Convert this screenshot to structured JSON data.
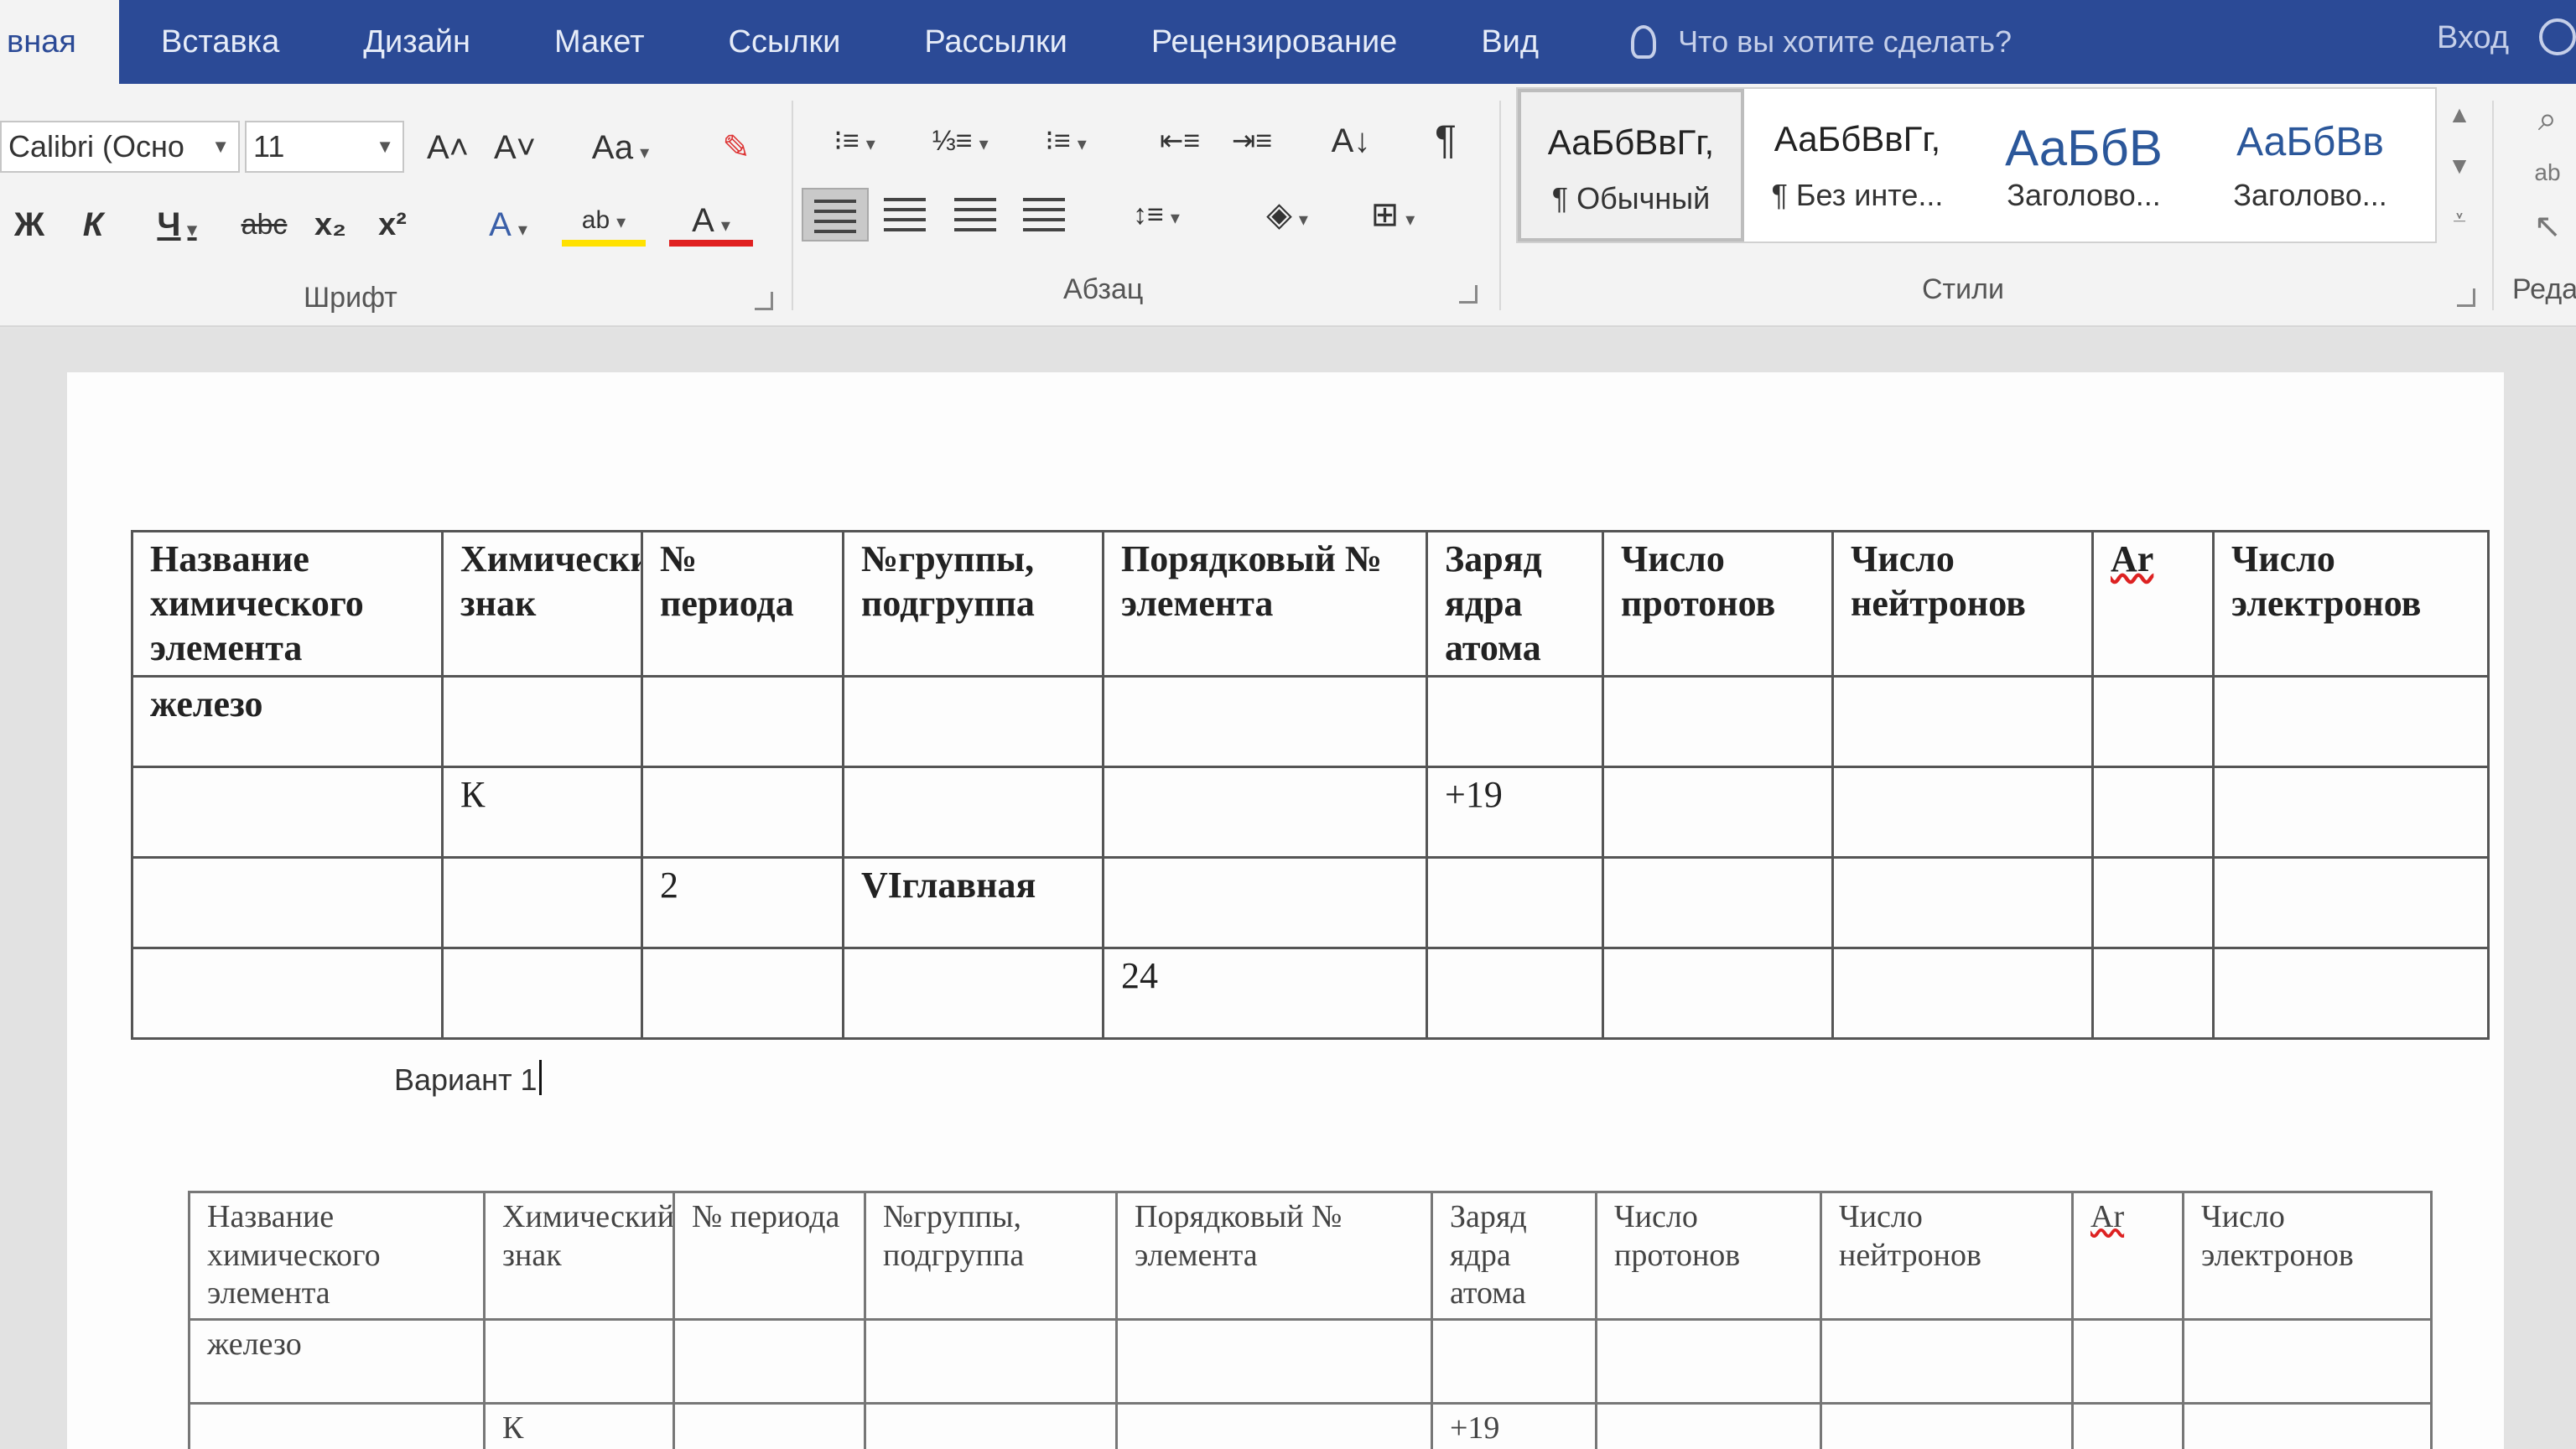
{
  "tabs": [
    "вная",
    "Вставка",
    "Дизайн",
    "Макет",
    "Ссылки",
    "Рассылки",
    "Рецензирование",
    "Вид"
  ],
  "tell_me": "Что вы хотите сделать?",
  "signin": "Вход",
  "font": {
    "name": "Calibri (Осно",
    "size": "11",
    "grow": "A˄",
    "shrink": "A˅",
    "case": "Аа",
    "bold": "Ж",
    "italic": "К",
    "underline": "Ч",
    "strike": "abc",
    "subscript": "x₂",
    "superscript": "x²",
    "group_label": "Шрифт"
  },
  "paragraph": {
    "group_label": "Абзац",
    "sort": "А↓",
    "pilcrow": "¶"
  },
  "styles": {
    "group_label": "Стили",
    "items": [
      {
        "preview": "АаБбВвГг,",
        "name": "¶ Обычный"
      },
      {
        "preview": "АаБбВвГг,",
        "name": "¶ Без инте..."
      },
      {
        "preview": "АаБбВ",
        "name": "Заголово..."
      },
      {
        "preview": "АаБбВв",
        "name": "Заголово..."
      }
    ]
  },
  "editing": {
    "group_label": "Реда"
  },
  "table_headers": [
    "Название химического элемента",
    "Химический знак",
    "№ периода",
    "№группы, подгруппа",
    "Порядковый № элемента",
    "Заряд ядра атома",
    "Число протонов",
    "Число нейтронов",
    "Ar",
    "Число электронов"
  ],
  "table1_rows": [
    [
      "железо",
      "",
      "",
      "",
      "",
      "",
      "",
      "",
      "",
      ""
    ],
    [
      "",
      "К",
      "",
      "",
      "",
      "+19",
      "",
      "",
      "",
      ""
    ],
    [
      "",
      "",
      "2",
      "VIглавная",
      "",
      "",
      "",
      "",
      "",
      ""
    ],
    [
      "",
      "",
      "",
      "",
      "24",
      "",
      "",
      "",
      "",
      ""
    ]
  ],
  "variant_label": "Вариант 1",
  "table2_rows": [
    [
      "железо",
      "",
      "",
      "",
      "",
      "",
      "",
      "",
      "",
      ""
    ],
    [
      "",
      "К",
      "",
      "",
      "",
      "+19",
      "",
      "",
      "",
      ""
    ]
  ]
}
